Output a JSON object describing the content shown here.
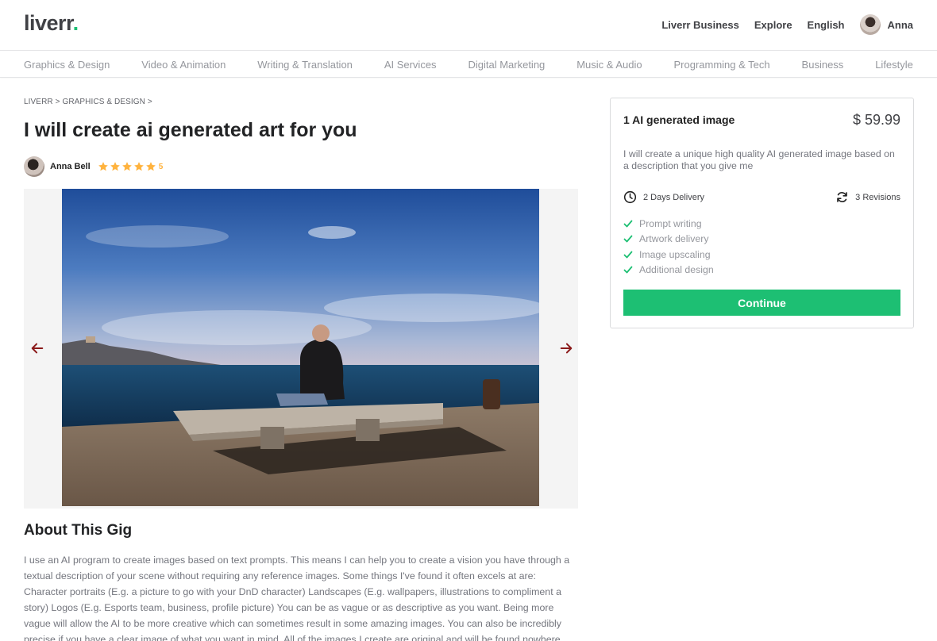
{
  "header": {
    "logo_text": "liverr",
    "logo_dot": ".",
    "nav": [
      "Liverr Business",
      "Explore",
      "English"
    ],
    "user_name": "Anna"
  },
  "categories": [
    "Graphics & Design",
    "Video & Animation",
    "Writing & Translation",
    "AI Services",
    "Digital Marketing",
    "Music & Audio",
    "Programming & Tech",
    "Business",
    "Lifestyle"
  ],
  "breadcrumb": [
    "LIVERR",
    "GRAPHICS & DESIGN"
  ],
  "gig": {
    "title": "I will create ai generated art for you",
    "seller_name": "Anna Bell",
    "rating": "5",
    "stars": 5
  },
  "about": {
    "title": "About This Gig",
    "text": "I use an AI program to create images based on text prompts. This means I can help you to create a vision you have through a textual description of your scene without requiring any reference images. Some things I've found it often excels at are: Character portraits (E.g. a picture to go with your DnD character) Landscapes (E.g. wallpapers, illustrations to compliment a story) Logos (E.g. Esports team, business, profile picture) You can be as vague or as descriptive as you want. Being more vague will allow the AI to be more creative which can sometimes result in some amazing images. You can also be incredibly precise if you have a clear image of what you want in mind. All of the images I create are original and will be found nowhere"
  },
  "package": {
    "name": "1 AI generated image",
    "price": "$ 59.99",
    "description": "I will create a unique high quality AI generated image based on a description that you give me",
    "delivery": "2 Days Delivery",
    "revisions": "3 Revisions",
    "features": [
      "Prompt writing",
      "Artwork delivery",
      "Image upscaling",
      "Additional design"
    ],
    "button_label": "Continue"
  },
  "colors": {
    "brand_green": "#1dbf73",
    "star_yellow": "#ffb33e",
    "arrow_red": "#8b1a1a"
  }
}
